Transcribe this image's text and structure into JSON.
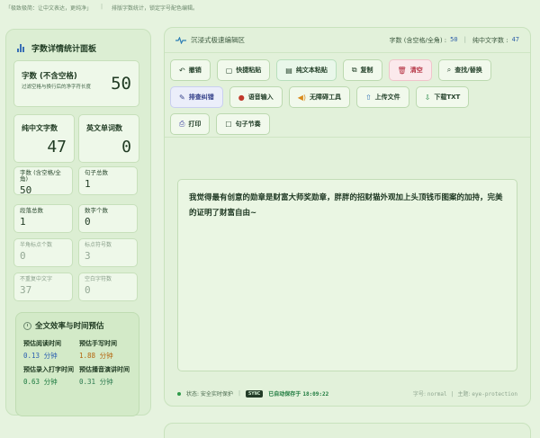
{
  "topline": {
    "left": "「极致极简：让中文表达，更纯净」",
    "right": "排版字数统计，锁定字号配色编辑。"
  },
  "stats_panel": {
    "title": "字数详情统计面板",
    "main": {
      "label": "字数 (不含空格)",
      "sub": "过滤空格与换行后的净字符长度",
      "value": "50"
    },
    "chinese": {
      "label": "纯中文字数",
      "value": "47"
    },
    "english": {
      "label": "英文单词数",
      "value": "0"
    },
    "small": [
      {
        "label": "字数 (含空格/全角)",
        "value": "50"
      },
      {
        "label": "句子总数",
        "value": "1"
      },
      {
        "label": "段落总数",
        "value": "1"
      },
      {
        "label": "数字个数",
        "value": "0"
      },
      {
        "label": "半角标点个数",
        "value": "0"
      },
      {
        "label": "标点符号数",
        "value": "3"
      },
      {
        "label": "不重复中文字",
        "value": "37"
      },
      {
        "label": "空白字符数",
        "value": "0"
      }
    ],
    "efficiency": {
      "title": "全文效率与时间预估",
      "items": [
        {
          "label": "预估阅读时间",
          "value": "0.13",
          "unit": "分钟"
        },
        {
          "label": "预估手写时间",
          "value": "1.88",
          "unit": "分钟"
        },
        {
          "label": "预估录入打字时间",
          "value": "0.63",
          "unit": "分钟"
        },
        {
          "label": "预估播音演讲时间",
          "value": "0.31",
          "unit": "分钟"
        }
      ]
    }
  },
  "editor_panel": {
    "title": "沉浸式极速编辑区",
    "stat1_label": "字数 (含空格/全角) :",
    "stat1_value": "50",
    "stat2_label": "纯中文字数 :",
    "stat2_value": "47",
    "toolbar": {
      "undo": "撤销",
      "quick_paste": "快捷粘贴",
      "plain_paste": "纯文本粘贴",
      "copy": "复制",
      "clear": "清空",
      "find_replace": "查找/替换",
      "format_fix": "排查纠错",
      "voice_input": "语音输入",
      "accessibility": "无障碍工具",
      "upload": "上传文件",
      "download": "下载TXT",
      "print": "打印",
      "sentence_rhythm": "句子节奏"
    },
    "content": "我觉得最有创意的勋章是财富大师奖勋章，胖胖的招财猫外观加上头顶钱币图案的加持，完美的证明了财富自由~",
    "status": {
      "state": "状态: 安全实时保护",
      "sync": "SYNC",
      "saved_prefix": "已自动保存于",
      "saved_time": "18:09:22",
      "font_label": "字号:",
      "font_value": "normal",
      "theme_label": "主题:",
      "theme_value": "eye-protection"
    }
  }
}
